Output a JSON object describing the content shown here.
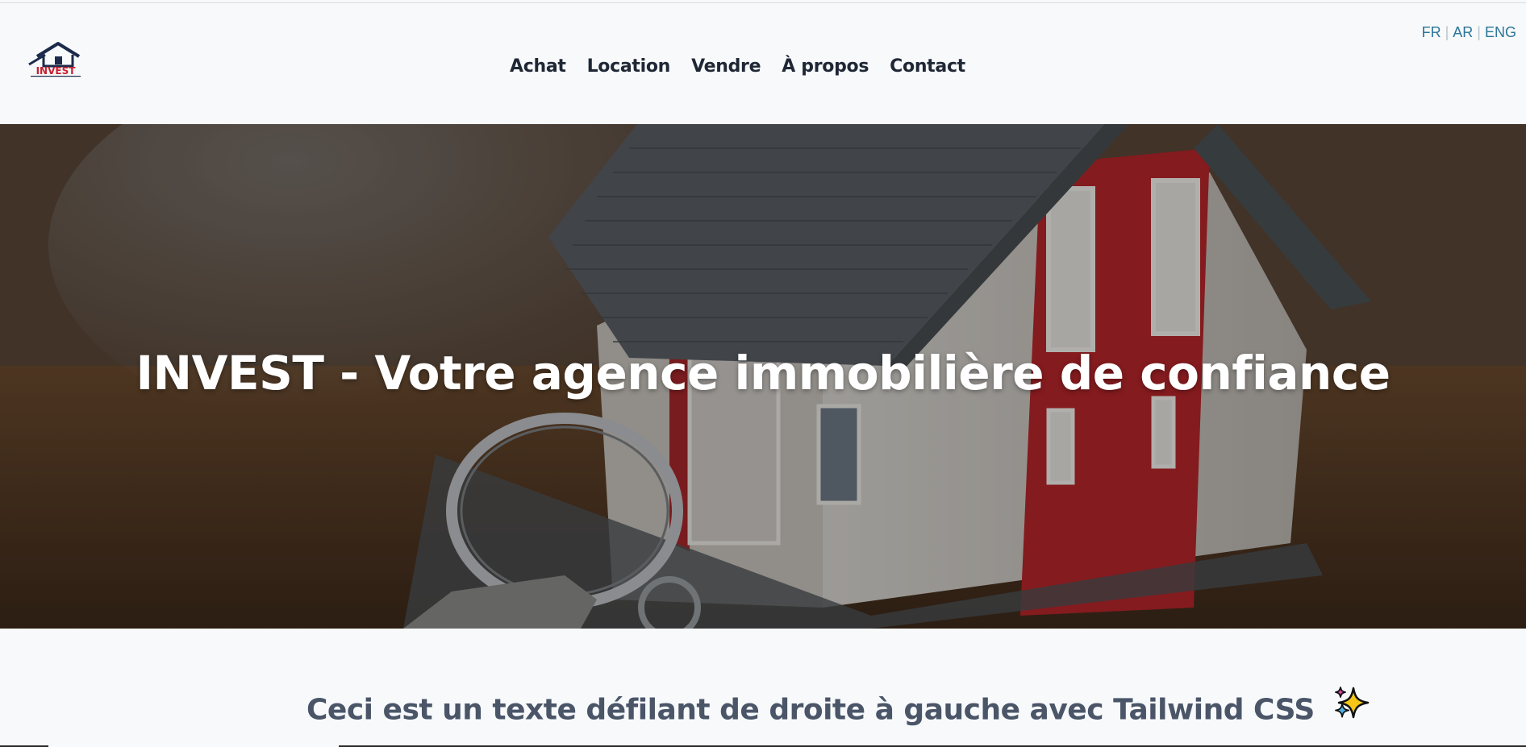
{
  "header": {
    "logo_text": "INVEST",
    "nav": [
      {
        "label": "Achat"
      },
      {
        "label": "Location"
      },
      {
        "label": "Vendre"
      },
      {
        "label": "À propos"
      },
      {
        "label": "Contact"
      }
    ],
    "languages": [
      "FR",
      "AR",
      "ENG"
    ],
    "language_separator": "|"
  },
  "hero": {
    "title": "INVEST - Votre agence immobilière de confiance",
    "background_image": "house-model-with-keys"
  },
  "marquee": {
    "text": "Ceci est un texte défilant de droite à gauche avec Tailwind CSS",
    "emoji_icon": "sparkles-icon"
  },
  "colors": {
    "nav_text": "#1f2735",
    "lang_link": "#2b7596",
    "marquee_text": "#4a5568",
    "logo_navy": "#1c2b4a",
    "logo_red": "#c8202f"
  }
}
